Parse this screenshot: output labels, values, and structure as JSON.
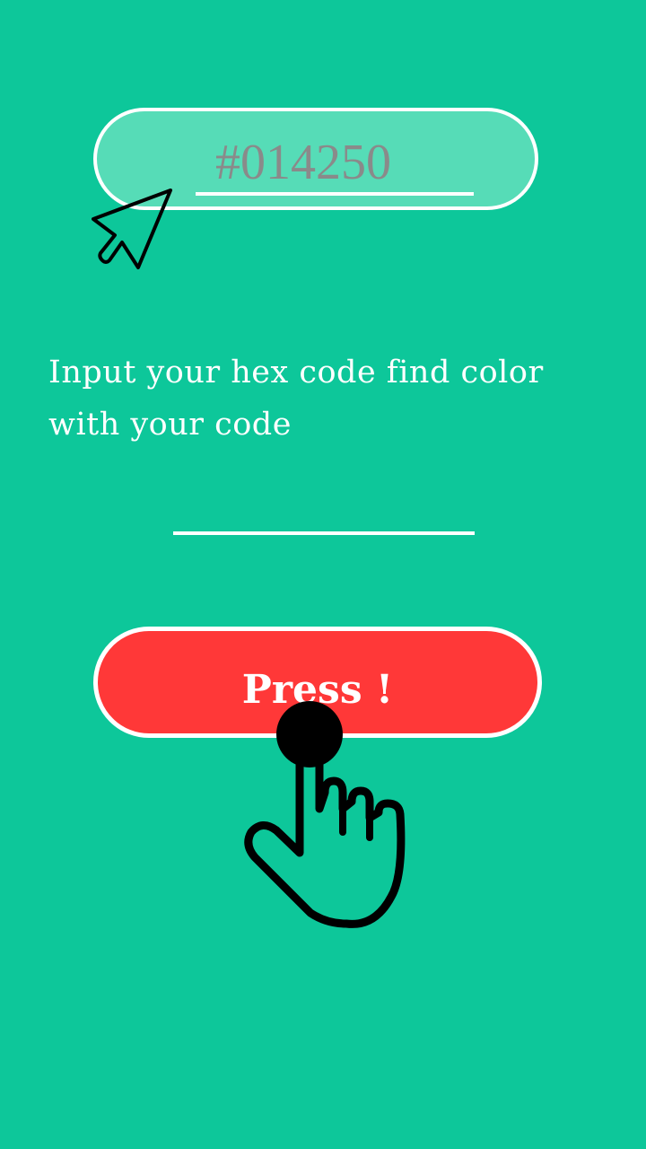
{
  "colors": {
    "background": "#0dc79a",
    "input_pill": "#56dcb7",
    "button": "#ff3838",
    "placeholder": "#8a8a8a",
    "text": "#ffffff"
  },
  "hex_input": {
    "placeholder": "#014250",
    "value": ""
  },
  "instructions": {
    "text": "Input your hex code find color with your code"
  },
  "press_button": {
    "label": "Press !"
  },
  "icons": {
    "pointer": "cursor-arrow-icon",
    "tap": "tap-hand-icon"
  }
}
